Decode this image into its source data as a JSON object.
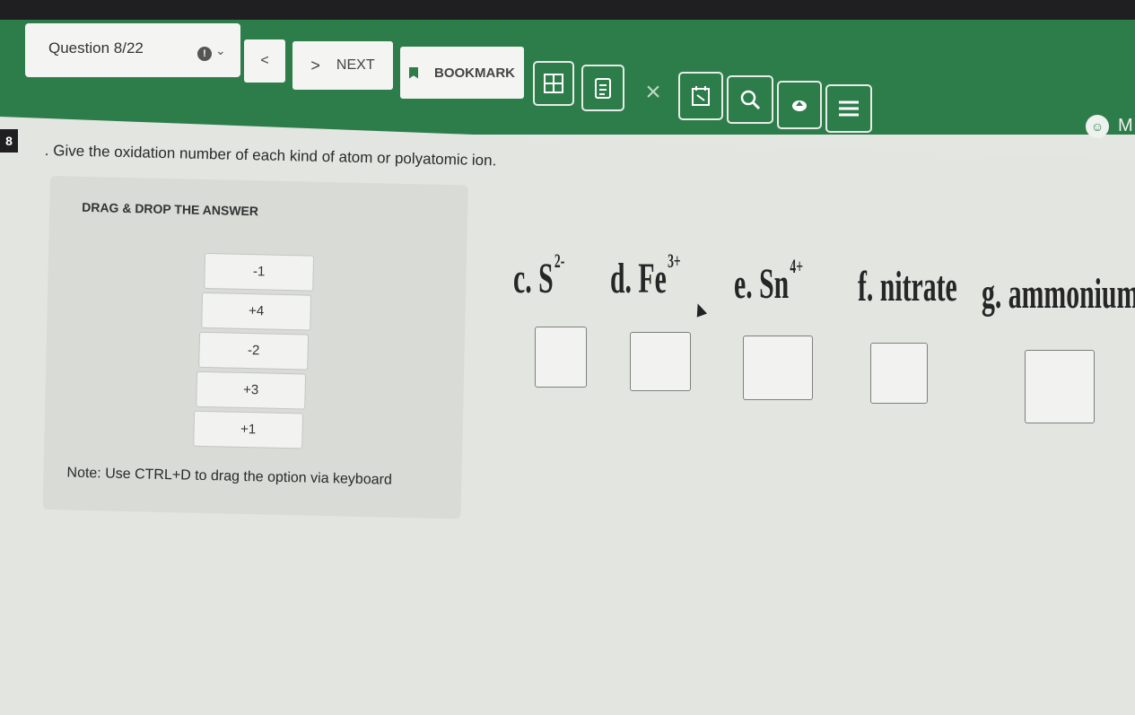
{
  "header": {
    "question_label": "Question 8/22",
    "flag_icon": "alert-icon",
    "flag_menu_icon": "chevron-down-icon",
    "prev_label": "<",
    "next_arrow": ">",
    "next_label": "NEXT",
    "bookmark_label": "BOOKMARK",
    "user_initial": "M",
    "tool_icons": [
      "calculator-icon",
      "notepad-icon",
      "close-icon",
      "timer-icon",
      "zoom-icon",
      "upload-icon",
      "menu-icon"
    ]
  },
  "question": {
    "number": "8",
    "text": ". Give the oxidation number of each kind of atom or polyatomic  ion."
  },
  "drag_panel": {
    "title": "DRAG & DROP THE ANSWER",
    "options": [
      "-1",
      "+4",
      "-2",
      "+3",
      "+1"
    ],
    "note": "Note: Use CTRL+D to drag the option via keyboard"
  },
  "targets": [
    {
      "prefix": "c. S",
      "charge": "2-"
    },
    {
      "prefix": "d. Fe",
      "charge": "3+"
    },
    {
      "prefix": "e. Sn",
      "charge": "4+"
    },
    {
      "prefix": "f. nitrate",
      "charge": ""
    },
    {
      "prefix": "g. ammonium",
      "charge": ""
    }
  ],
  "colors": {
    "brand_green": "#2d7d4a",
    "background": "#e3e5e1",
    "panel": "#d9dbd7"
  }
}
